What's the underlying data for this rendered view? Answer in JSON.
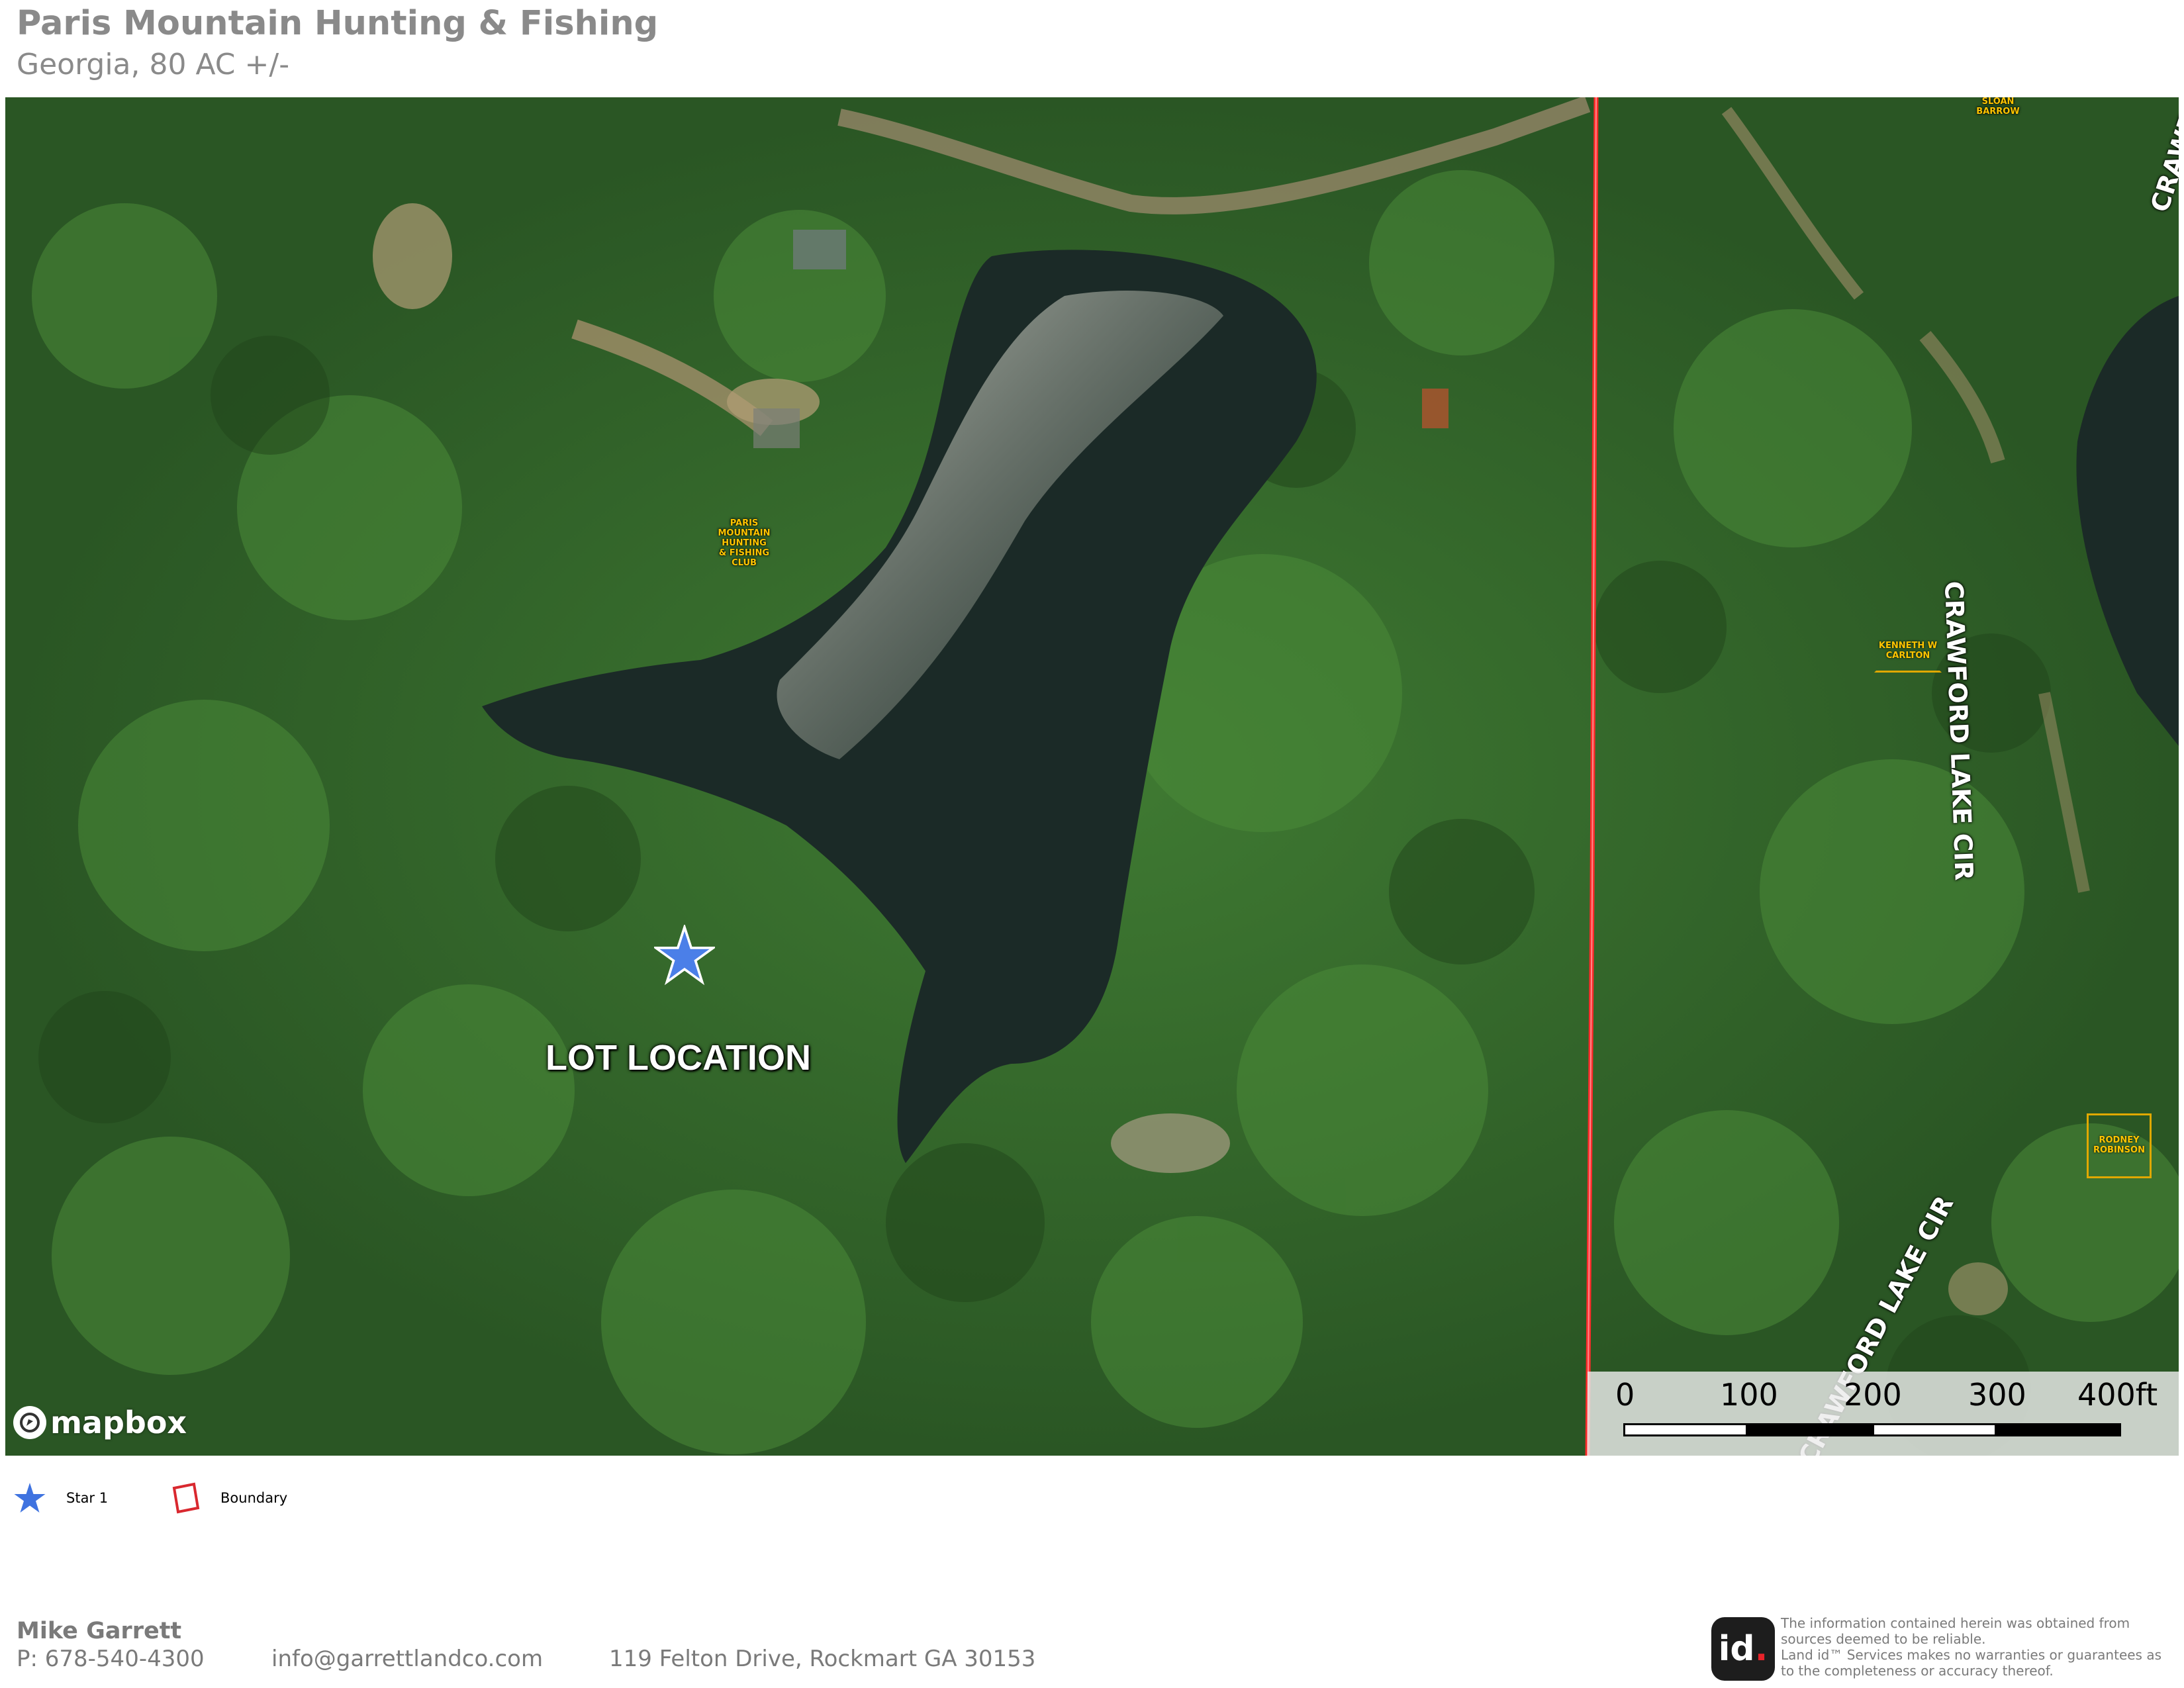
{
  "header": {
    "title": "Paris Mountain Hunting & Fishing",
    "subtitle": "Georgia, 80 AC +/-"
  },
  "map": {
    "basemap": "satellite imagery",
    "map_labels": {
      "club": "PARIS\nMOUNTAIN\nHUNTING\n& FISHING\nCLUB",
      "sloan": "SLOAN\nBARROW",
      "kenneth": "KENNETH W\nCARLTON",
      "rodney": "RODNEY\nROBINSON"
    },
    "roads": {
      "crawford_lake_cir": "CRAWFORD LAKE CIR",
      "crawford_edge": "CRAWFOR",
      "lower_road": "CRAWFORD LAKE CIR"
    },
    "lot_label": "LOT LOCATION",
    "marker_icon": "star-icon",
    "boundary_color": "#ff2a2a",
    "attribution": "mapbox",
    "scale": {
      "ticks": [
        "0",
        "100",
        "200",
        "300",
        "400ft"
      ]
    }
  },
  "legend": {
    "items": [
      {
        "icon": "star-icon",
        "label": "Star 1",
        "color": "#3f73e0"
      },
      {
        "icon": "boundary-polygon-icon",
        "label": "Boundary",
        "color": "#d9282f"
      }
    ]
  },
  "footer": {
    "agent_name": "Mike Garrett",
    "phone": "P: 678-540-4300",
    "email": "info@garrettlandco.com",
    "address": "119 Felton Drive, Rockmart GA 30153",
    "logo_text": "id",
    "logo_dot": ".",
    "disclaimer": "The information contained herein was obtained from sources deemed to be reliable.\n Land id™ Services makes no warranties or guarantees as to the completeness or accuracy thereof."
  }
}
